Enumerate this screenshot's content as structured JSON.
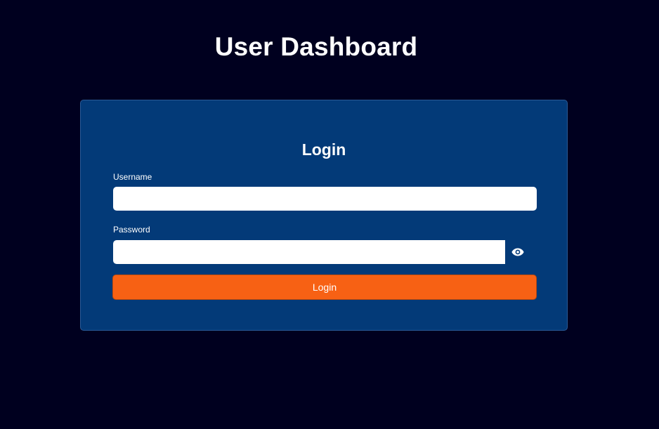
{
  "header": {
    "title": "User Dashboard"
  },
  "login_form": {
    "title": "Login",
    "username_label": "Username",
    "username_value": "",
    "password_label": "Password",
    "password_value": "",
    "password_toggle_icon": "eye-icon",
    "submit_label": "Login"
  },
  "colors": {
    "background": "#00001f",
    "card": "#033a78",
    "button": "#f76114",
    "text": "#ffffff"
  }
}
